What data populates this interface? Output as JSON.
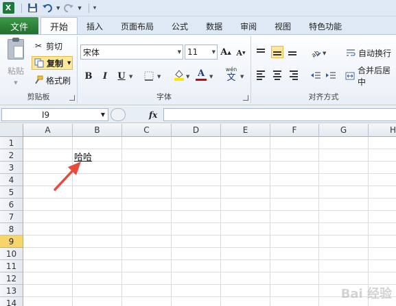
{
  "app": {
    "colors": {
      "file_tab": "#1f7a33",
      "selection": "#fde89a",
      "arrow": "#e84a3c",
      "font_color_bar": "#d00000",
      "fill_color_bar": "#ffe600"
    }
  },
  "quick_access": {
    "icons": [
      "excel-icon",
      "save-icon",
      "undo-icon",
      "redo-icon",
      "customize-icon"
    ]
  },
  "tabs": [
    "文件",
    "开始",
    "插入",
    "页面布局",
    "公式",
    "数据",
    "审阅",
    "视图",
    "特色功能"
  ],
  "active_tab": "开始",
  "ribbon": {
    "clipboard": {
      "paste": "粘贴",
      "cut": "剪切",
      "copy": "复制",
      "format_painter": "格式刷",
      "label": "剪贴板"
    },
    "font": {
      "font_name": "宋体",
      "font_size": "11",
      "bold": "B",
      "italic": "I",
      "underline": "U",
      "wen": "wén",
      "wen_char": "文",
      "label": "字体"
    },
    "alignment": {
      "wrap_text": "自动换行",
      "merge_center": "合并后居中",
      "label": "对齐方式"
    }
  },
  "formula_bar": {
    "name_box": "I9",
    "fx": "fx",
    "formula": ""
  },
  "sheet": {
    "columns": [
      "A",
      "B",
      "C",
      "D",
      "E",
      "F",
      "G",
      "H"
    ],
    "rows": [
      "1",
      "2",
      "3",
      "4",
      "5",
      "6",
      "7",
      "8",
      "9",
      "10",
      "11",
      "12",
      "13",
      "14"
    ],
    "selected_row": "9",
    "cell_B2": "哈哈"
  },
  "watermark": "Bai 经验"
}
